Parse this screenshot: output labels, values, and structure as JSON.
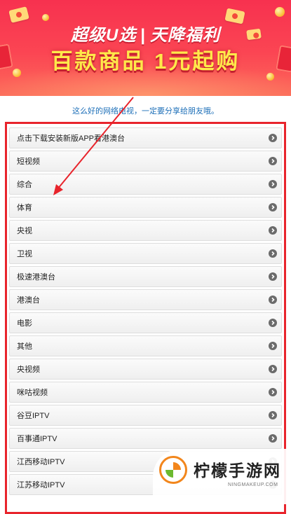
{
  "banner": {
    "line1_left": "超级U选",
    "line1_sep": "|",
    "line1_right": "天降福利",
    "line2": "百款商品 1元起购"
  },
  "tip": "这么好的网络电视，一定要分享给朋友哦。",
  "channels": [
    {
      "label": "点击下载安装新版APP看港澳台"
    },
    {
      "label": "短视频"
    },
    {
      "label": "综合"
    },
    {
      "label": "体育"
    },
    {
      "label": "央视"
    },
    {
      "label": "卫视"
    },
    {
      "label": "极速港澳台"
    },
    {
      "label": "港澳台"
    },
    {
      "label": "电影"
    },
    {
      "label": "其他"
    },
    {
      "label": "央视频"
    },
    {
      "label": "咪咕视频"
    },
    {
      "label": "谷豆IPTV"
    },
    {
      "label": "百事通IPTV"
    },
    {
      "label": "江西移动IPTV"
    },
    {
      "label": "江苏移动IPTV"
    }
  ],
  "watermark": {
    "title": "柠檬手游网",
    "url": "NINGMAKEUP.COM"
  },
  "colors": {
    "banner": "#f7314f",
    "highlight_frame": "#e8242c",
    "tip_text": "#1d6fb8",
    "arrow": "#e8242c"
  },
  "icons": {
    "item_chevron": "chevron-right-circle-icon",
    "annotation": "arrow-icon"
  }
}
